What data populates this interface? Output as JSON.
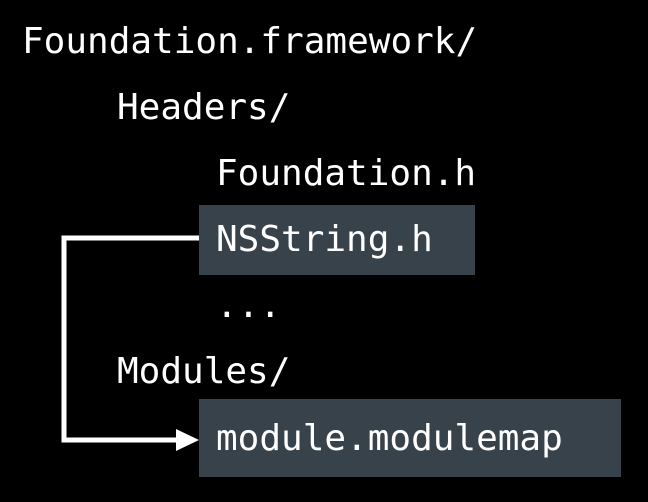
{
  "tree": {
    "root": "Foundation.framework/",
    "headers_dir": "Headers/",
    "header_foundation": "Foundation.h",
    "header_nsstring": "NSString.h",
    "ellipsis": "...",
    "modules_dir": "Modules/",
    "modulemap": "module.modulemap"
  },
  "colors": {
    "background": "#000000",
    "text": "#ffffff",
    "highlight": "#37424b",
    "arrow": "#ffffff"
  },
  "icons": {
    "arrow": "arrow-right-icon"
  }
}
